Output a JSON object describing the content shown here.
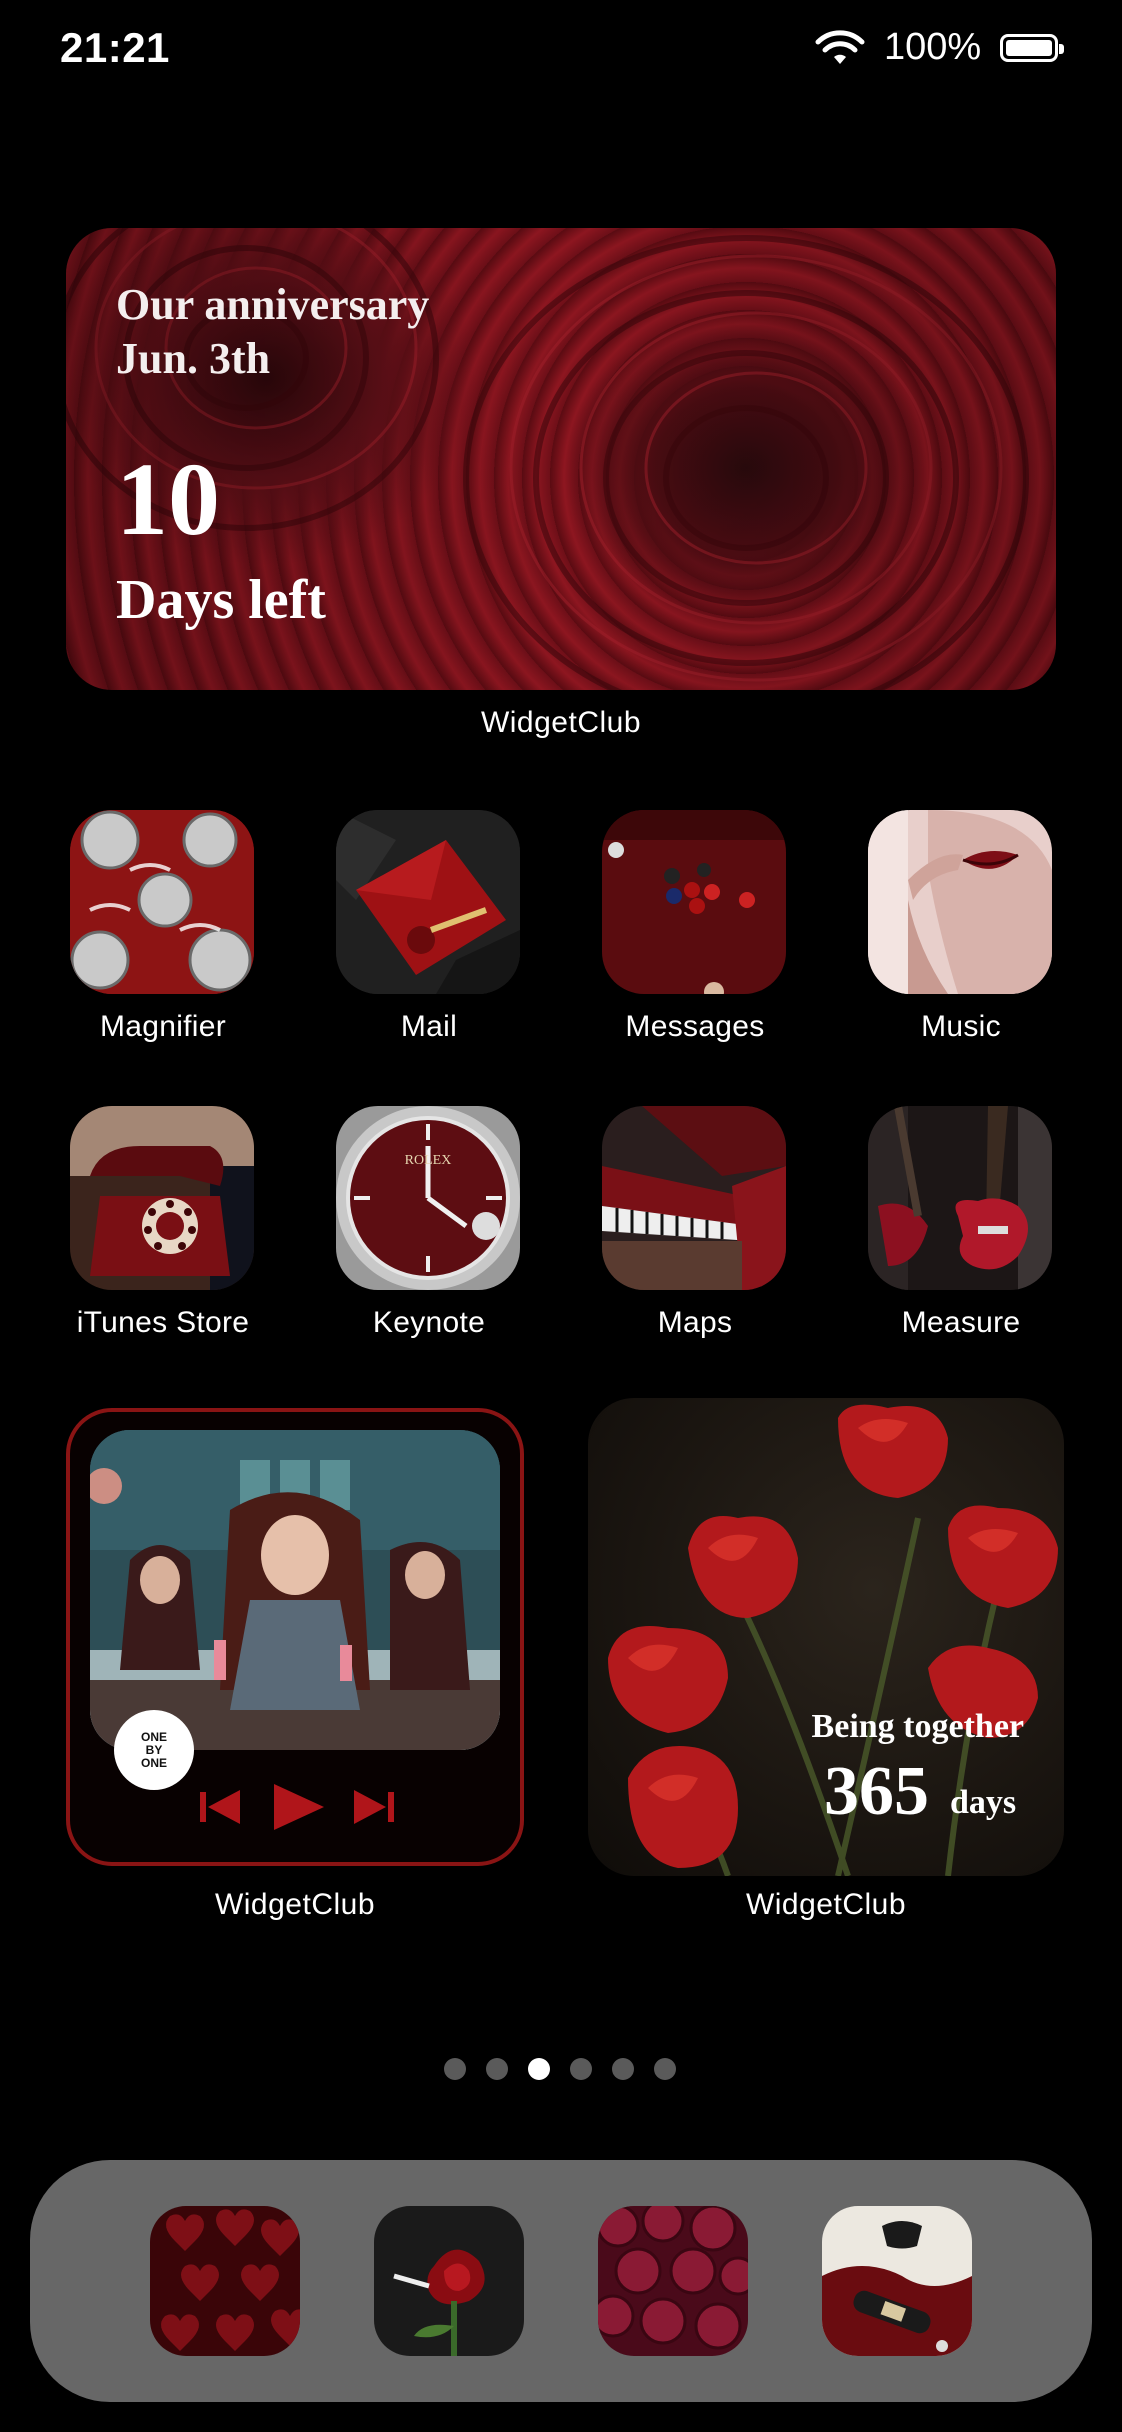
{
  "status_bar": {
    "time": "21:21",
    "battery_percent": "100%",
    "icons": [
      "wifi-icon",
      "battery-icon"
    ]
  },
  "anniversary_widget": {
    "line1": "Our anniversary",
    "line2": "Jun. 3th",
    "count": "10",
    "caption": "Days left",
    "app_label": "WidgetClub"
  },
  "apps": [
    {
      "label": "Magnifier",
      "icon": "coca-cola-cans-icon"
    },
    {
      "label": "Mail",
      "icon": "red-envelope-icon"
    },
    {
      "label": "Messages",
      "icon": "billiard-table-icon"
    },
    {
      "label": "Music",
      "icon": "red-lips-icon"
    },
    {
      "label": "iTunes Store",
      "icon": "rotary-telephone-icon"
    },
    {
      "label": "Keynote",
      "icon": "wristwatch-icon"
    },
    {
      "label": "Maps",
      "icon": "grand-piano-icon"
    },
    {
      "label": "Measure",
      "icon": "electric-guitar-icon"
    }
  ],
  "music_widget": {
    "disc_text": "ONE BY ONE",
    "app_label": "WidgetClub",
    "controls": [
      "previous-icon",
      "play-icon",
      "next-icon"
    ]
  },
  "tulip_widget": {
    "line1": "Being together",
    "count": "365",
    "unit": "days",
    "app_label": "WidgetClub"
  },
  "page_indicator": {
    "pages": 6,
    "current": 3
  },
  "dock": {
    "apps": [
      {
        "icon": "heart-chocolates-icon"
      },
      {
        "icon": "rose-icon"
      },
      {
        "icon": "raspberries-icon"
      },
      {
        "icon": "wine-bottle-icon"
      }
    ]
  },
  "colors": {
    "accent_red": "#8a1414",
    "dock_bg": "#676767",
    "background": "#000000"
  }
}
